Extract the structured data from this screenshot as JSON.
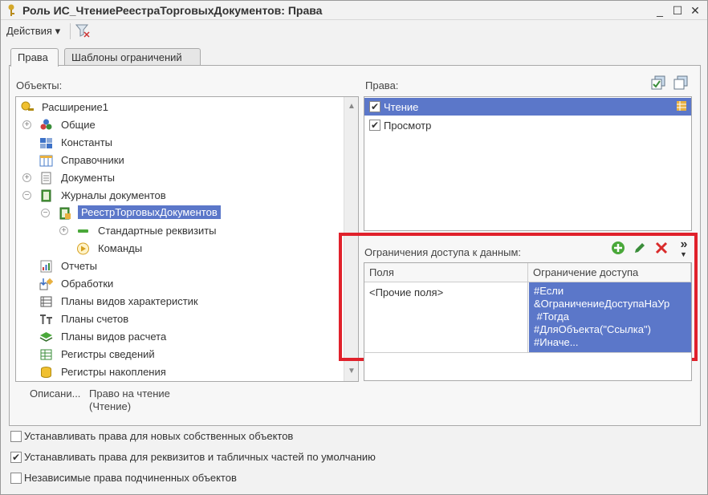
{
  "window": {
    "title": "Роль ИС_ЧтениеРеестраТорговыхДокументов: Права",
    "minimize": "_",
    "maximize": "☐",
    "close": "✕"
  },
  "toolbar": {
    "actions_label": "Действия ▾"
  },
  "tabs": [
    {
      "label": "Права"
    },
    {
      "label": "Шаблоны ограничений"
    }
  ],
  "objects": {
    "label": "Объекты:",
    "tree": [
      {
        "label": "Расширение1",
        "icon": "key-icon"
      },
      {
        "label": "Общие",
        "icon": "common-icon"
      },
      {
        "label": "Константы",
        "icon": "constants-icon"
      },
      {
        "label": "Справочники",
        "icon": "catalogs-icon"
      },
      {
        "label": "Документы",
        "icon": "documents-icon"
      },
      {
        "label": "Журналы документов",
        "icon": "journals-icon"
      },
      {
        "label": "РеестрТорговыхДокументов",
        "icon": "journal-icon"
      },
      {
        "label": "Стандартные реквизиты",
        "icon": "attribute-icon"
      },
      {
        "label": "Команды",
        "icon": "command-icon"
      },
      {
        "label": "Отчеты",
        "icon": "reports-icon"
      },
      {
        "label": "Обработки",
        "icon": "dataprocessors-icon"
      },
      {
        "label": "Планы видов характеристик",
        "icon": "chart-of-characteristics-icon"
      },
      {
        "label": "Планы счетов",
        "icon": "chart-of-accounts-icon"
      },
      {
        "label": "Планы видов расчета",
        "icon": "chart-of-calculation-icon"
      },
      {
        "label": "Регистры сведений",
        "icon": "information-registers-icon"
      },
      {
        "label": "Регистры накопления",
        "icon": "accumulation-registers-icon"
      }
    ]
  },
  "description": {
    "label": "Описани...",
    "value_line1": "Право на чтение",
    "value_line2": "(Чтение)"
  },
  "rights": {
    "label": "Права:",
    "items": [
      {
        "label": "Чтение",
        "checked": true,
        "selected": true
      },
      {
        "label": "Просмотр",
        "checked": true,
        "selected": false
      }
    ]
  },
  "restrictions": {
    "label": "Ограничения доступа к данным:",
    "columns": [
      "Поля",
      "Ограничение доступа"
    ],
    "rows": [
      {
        "fields": "<Прочие поля>",
        "condition": "#Если\n&ОграничениеДоступаНаУр\n #Тогда\n#ДляОбъекта(\"Ссылка\")\n#Иначе..."
      }
    ],
    "more_icon": "»"
  },
  "options": [
    {
      "label": "Устанавливать права для новых собственных объектов",
      "checked": false
    },
    {
      "label": "Устанавливать права для реквизитов и табличных частей по умолчанию",
      "checked": true
    },
    {
      "label": "Независимые права подчиненных объектов",
      "checked": false
    }
  ],
  "colors": {
    "selection": "#5b77c9",
    "highlight_box": "#e0212b"
  }
}
